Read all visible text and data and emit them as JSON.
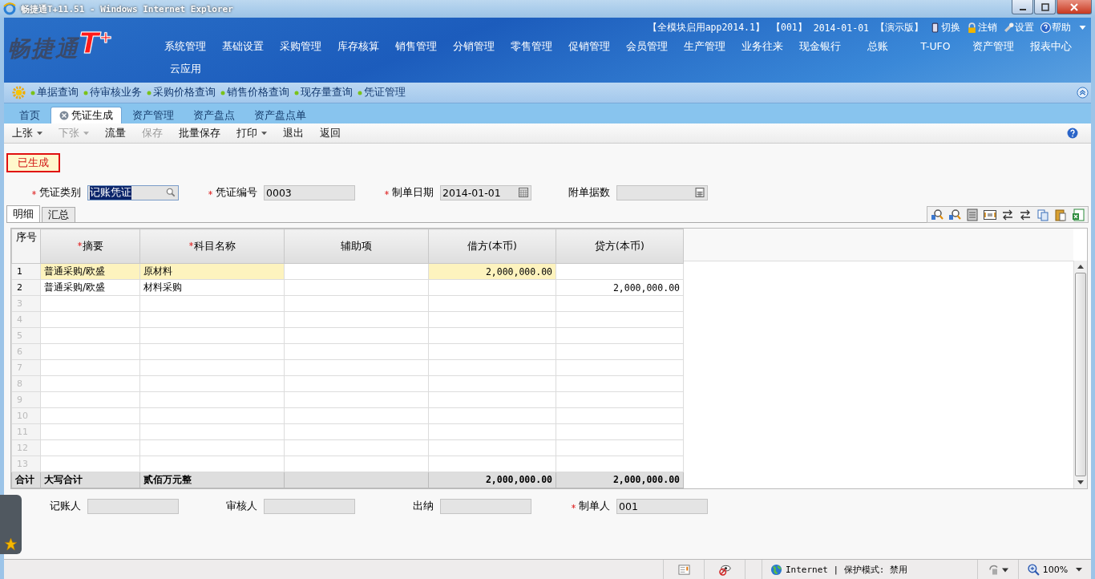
{
  "window": {
    "title": "畅捷通T+11.51 - Windows Internet Explorer"
  },
  "logo": {
    "name": "畅捷通",
    "mark": "T",
    "sup": "+"
  },
  "header_info": [
    "【全模块启用app2014.1】",
    "【001】",
    "2014-01-01",
    "【演示版】"
  ],
  "header_links": [
    {
      "label": "切换",
      "kind": "switch"
    },
    {
      "label": "注销",
      "kind": "lock"
    },
    {
      "label": "设置",
      "kind": "settings"
    },
    {
      "label": "帮助",
      "kind": "help"
    }
  ],
  "nav_menu": [
    "系统管理",
    "基础设置",
    "采购管理",
    "库存核算",
    "销售管理",
    "分销管理",
    "零售管理",
    "促销管理",
    "会员管理",
    "生产管理",
    "业务往来",
    "现金银行",
    "总账",
    "T-UFO",
    "资产管理",
    "报表中心",
    "云应用"
  ],
  "quick_links": [
    "单据查询",
    "待审核业务",
    "采购价格查询",
    "销售价格查询",
    "现存量查询",
    "凭证管理"
  ],
  "tabs": [
    {
      "label": "首页",
      "selected": false,
      "closable": false
    },
    {
      "label": "凭证生成",
      "selected": true,
      "closable": true
    },
    {
      "label": "资产管理",
      "selected": false,
      "closable": false
    },
    {
      "label": "资产盘点",
      "selected": false,
      "closable": false
    },
    {
      "label": "资产盘点单",
      "selected": false,
      "closable": false
    }
  ],
  "toolbar": [
    {
      "label": "上张",
      "disabled": false,
      "dropdown": true
    },
    {
      "label": "下张",
      "disabled": true,
      "dropdown": true
    },
    {
      "label": "流量",
      "disabled": false,
      "dropdown": false
    },
    {
      "label": "保存",
      "disabled": true,
      "dropdown": false
    },
    {
      "label": "批量保存",
      "disabled": false,
      "dropdown": false
    },
    {
      "label": "打印",
      "disabled": false,
      "dropdown": true
    },
    {
      "label": "退出",
      "disabled": false,
      "dropdown": false
    },
    {
      "label": "返回",
      "disabled": false,
      "dropdown": false
    }
  ],
  "status_badge": "已生成",
  "form_fields": [
    {
      "label": "凭证类别",
      "value": "记账凭证",
      "required": true,
      "kind": "lookup",
      "value_selected": true
    },
    {
      "label": "凭证编号",
      "value": "0003",
      "required": true,
      "kind": "text",
      "value_selected": false
    },
    {
      "label": "制单日期",
      "value": "2014-01-01",
      "required": true,
      "kind": "date",
      "value_selected": false
    },
    {
      "label": "附单据数",
      "required": false,
      "kind": "calc",
      "value_selected": false
    }
  ],
  "detail_tabs": [
    {
      "label": "明细",
      "selected": true
    },
    {
      "label": "汇总",
      "selected": false
    }
  ],
  "table": {
    "columns": [
      {
        "label": "序号",
        "required": false
      },
      {
        "label": "摘要",
        "required": true
      },
      {
        "label": "科目名称",
        "required": true
      },
      {
        "label": "辅助项",
        "required": false
      },
      {
        "label": "借方(本币)",
        "required": false
      },
      {
        "label": "贷方(本币)",
        "required": false
      }
    ],
    "rows": [
      {
        "no": "1",
        "summary": "普通采购/欧盛",
        "account": "原材料",
        "debit": "2,000,000.00",
        "selected": true
      },
      {
        "no": "2",
        "summary": "普通采购/欧盛",
        "account": "材料采购",
        "credit": "2,000,000.00",
        "selected": false
      },
      {
        "no": "3",
        "selected": false
      },
      {
        "no": "4",
        "selected": false
      },
      {
        "no": "5",
        "selected": false
      },
      {
        "no": "6",
        "selected": false
      },
      {
        "no": "7",
        "selected": false
      },
      {
        "no": "8",
        "selected": false
      },
      {
        "no": "9",
        "selected": false
      },
      {
        "no": "10",
        "selected": false
      },
      {
        "no": "11",
        "selected": false
      },
      {
        "no": "12",
        "selected": false
      },
      {
        "no": "13",
        "selected": false
      }
    ],
    "total": {
      "label": "合计",
      "caption": "大写合计",
      "amount_words": "贰佰万元整",
      "debit": "2,000,000.00",
      "credit": "2,000,000.00"
    }
  },
  "footer_fields": [
    {
      "label": "记账人",
      "required": false
    },
    {
      "label": "审核人",
      "required": false
    },
    {
      "label": "出纳",
      "required": false
    },
    {
      "label": "制单人",
      "value": "001",
      "required": true
    }
  ],
  "status_bar": {
    "zone": "Internet | 保护模式: 禁用",
    "zoom": "100%"
  }
}
